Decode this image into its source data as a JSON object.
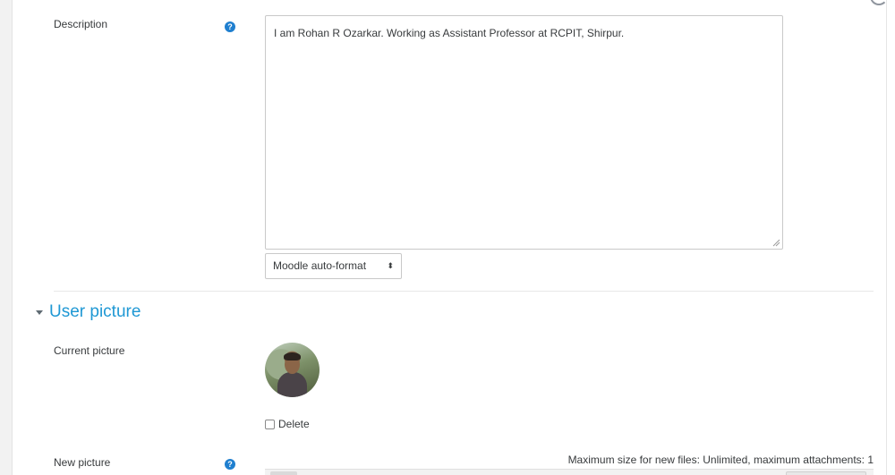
{
  "form": {
    "description": {
      "label": "Description",
      "help_icon": "question-circle-icon",
      "value": "I am Rohan R Ozarkar. Working as Assistant Professor at RCPIT, Shirpur.",
      "format_select": "Moodle auto-format",
      "select_arrows": "⬍"
    },
    "user_picture_section": {
      "title": "User picture",
      "toggle_icon": "caret-down-icon",
      "current_picture": {
        "label": "Current picture",
        "avatar_icon": "user-avatar"
      },
      "delete_label": "Delete",
      "new_picture": {
        "label": "New picture",
        "help_icon": "question-circle-icon",
        "limits": "Maximum size for new files: Unlimited, maximum attachments: 1"
      }
    }
  },
  "colors": {
    "accent": "#1f98d4",
    "help_icon": "#1f7fcf",
    "text": "#373a3c",
    "border": "#c9c9c9"
  }
}
